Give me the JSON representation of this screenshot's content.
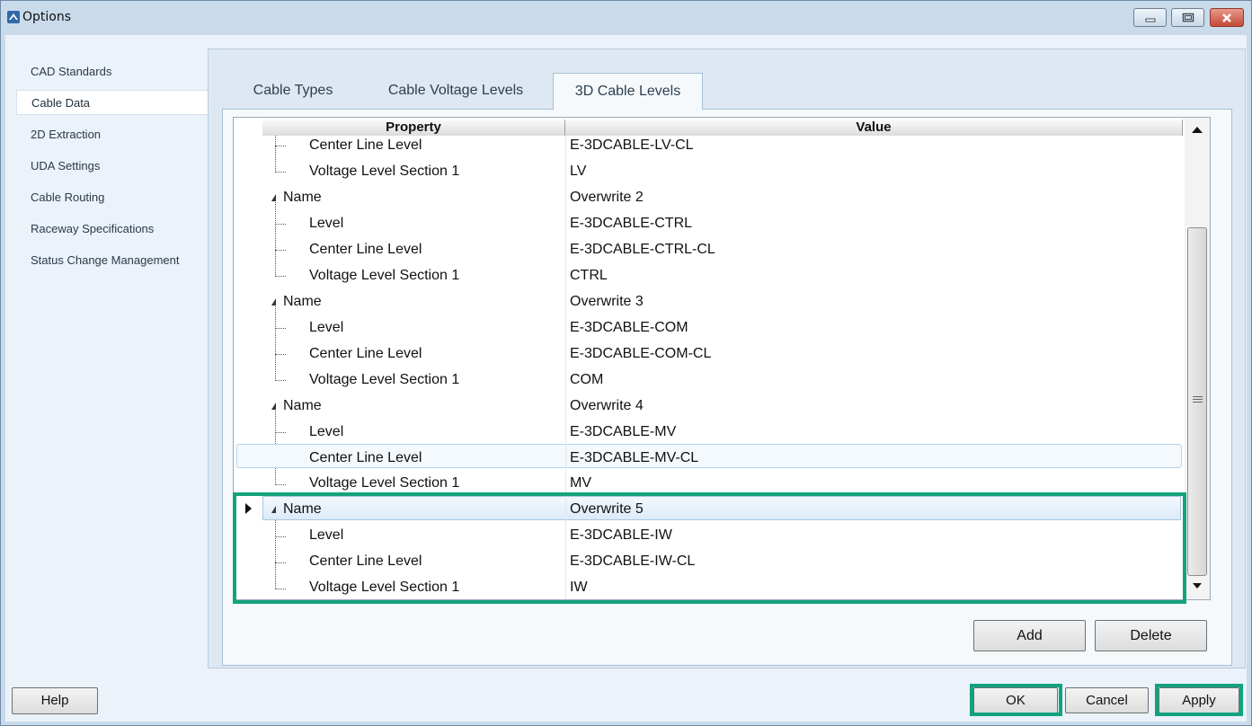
{
  "window": {
    "title": "Options"
  },
  "sidebar": {
    "items": [
      {
        "label": "CAD Standards"
      },
      {
        "label": "Cable Data"
      },
      {
        "label": "2D Extraction"
      },
      {
        "label": "UDA Settings"
      },
      {
        "label": "Cable Routing"
      },
      {
        "label": "Raceway Specifications"
      },
      {
        "label": "Status Change Management"
      }
    ],
    "selected": "Cable Data"
  },
  "tabs": [
    {
      "label": "Cable Types"
    },
    {
      "label": "Cable Voltage Levels"
    },
    {
      "label": "3D Cable Levels"
    }
  ],
  "active_tab": "3D Cable Levels",
  "grid": {
    "headers": {
      "property": "Property",
      "value": "Value"
    },
    "rows": [
      {
        "property": "Center Line Level",
        "value": "E-3DCABLE-LV-CL"
      },
      {
        "property": "Voltage Level Section 1",
        "value": "LV"
      },
      {
        "property": "Name",
        "value": "Overwrite 2"
      },
      {
        "property": "Level",
        "value": "E-3DCABLE-CTRL"
      },
      {
        "property": "Center Line Level",
        "value": "E-3DCABLE-CTRL-CL"
      },
      {
        "property": "Voltage Level Section 1",
        "value": "CTRL"
      },
      {
        "property": "Name",
        "value": "Overwrite 3"
      },
      {
        "property": "Level",
        "value": "E-3DCABLE-COM"
      },
      {
        "property": "Center Line Level",
        "value": "E-3DCABLE-COM-CL"
      },
      {
        "property": "Voltage Level Section 1",
        "value": "COM"
      },
      {
        "property": "Name",
        "value": "Overwrite 4"
      },
      {
        "property": "Level",
        "value": "E-3DCABLE-MV"
      },
      {
        "property": "Center Line Level",
        "value": "E-3DCABLE-MV-CL"
      },
      {
        "property": "Voltage Level Section 1",
        "value": "MV"
      },
      {
        "property": "Name",
        "value": "Overwrite 5"
      },
      {
        "property": "Level",
        "value": "E-3DCABLE-IW"
      },
      {
        "property": "Center Line Level",
        "value": "E-3DCABLE-IW-CL"
      },
      {
        "property": "Voltage Level Section 1",
        "value": "IW"
      }
    ]
  },
  "buttons": {
    "add": "Add",
    "delete": "Delete",
    "help": "Help",
    "ok": "OK",
    "cancel": "Cancel",
    "apply": "Apply"
  },
  "icons": {
    "minimize": "minimize-icon",
    "maximize": "maximize-icon",
    "close": "close-icon",
    "expander": "collapse-triangle-icon",
    "row_pointer": "row-pointer-icon"
  },
  "colors": {
    "highlight": "#12a27c",
    "window_bg": "#ebf2f9",
    "close_button": "#c44a35"
  }
}
